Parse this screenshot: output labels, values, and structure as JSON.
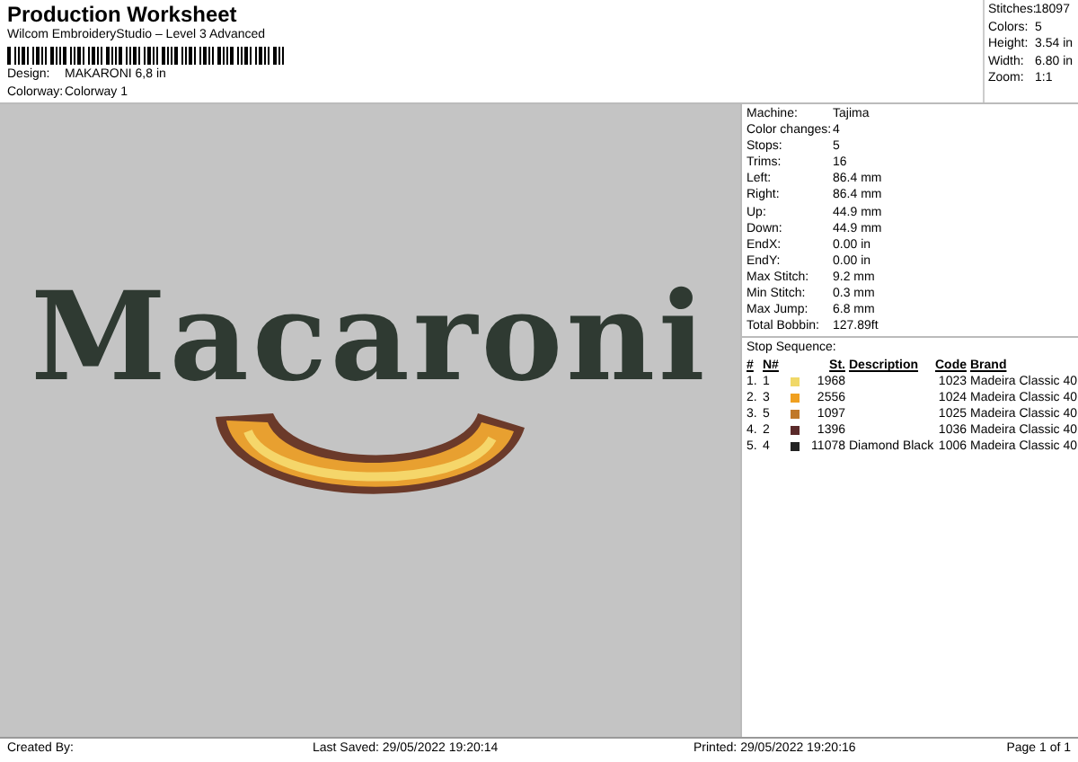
{
  "header": {
    "title": "Production Worksheet",
    "subtitle": "Wilcom EmbroideryStudio – Level 3 Advanced",
    "fields": [
      {
        "label": "Design:",
        "value": "MAKARONI 6,8 in"
      },
      {
        "label": "Colorway:",
        "value": "Colorway 1"
      }
    ]
  },
  "summary": [
    {
      "label": "Stitches:",
      "value": "18097"
    },
    {
      "label": "Colors:",
      "value": "5"
    },
    {
      "label": "Height:",
      "value": "3.54 in"
    },
    {
      "label": "Width:",
      "value": "6.80 in"
    },
    {
      "label": "Zoom:",
      "value": "1:1"
    }
  ],
  "design": {
    "text": "Macaroni"
  },
  "details": [
    {
      "label": "Machine:",
      "value": "Tajima"
    },
    {
      "label": "Color changes:",
      "value": "4"
    },
    {
      "label": "Stops:",
      "value": "5"
    },
    {
      "label": "Trims:",
      "value": "16"
    },
    {
      "label": "Left:",
      "value": "86.4 mm"
    },
    {
      "label": "Right:",
      "value": "86.4 mm"
    },
    {
      "label": "Up:",
      "value": "44.9 mm"
    },
    {
      "label": "Down:",
      "value": "44.9 mm"
    },
    {
      "label": "EndX:",
      "value": "0.00 in"
    },
    {
      "label": "EndY:",
      "value": "0.00 in"
    },
    {
      "label": "Max Stitch:",
      "value": "9.2 mm"
    },
    {
      "label": "Min Stitch:",
      "value": "0.3 mm"
    },
    {
      "label": "Max Jump:",
      "value": "6.8 mm"
    },
    {
      "label": "Total Bobbin:",
      "value": "127.89ft"
    }
  ],
  "stop_sequence": {
    "title": "Stop Sequence:",
    "columns": [
      "#",
      "N#",
      "St.",
      "Description",
      "Code",
      "Brand"
    ],
    "rows": [
      {
        "index": "1.",
        "needle": "1",
        "color": "#f0d868",
        "stitches": "1968",
        "code": "1023",
        "brand": "Madeira Classic 40"
      },
      {
        "index": "2.",
        "needle": "3",
        "color": "#f0a020",
        "stitches": "2556",
        "code": "1024",
        "brand": "Madeira Classic 40"
      },
      {
        "index": "3.",
        "needle": "5",
        "color": "#c07828",
        "stitches": "1097",
        "code": "1025",
        "brand": "Madeira Classic 40"
      },
      {
        "index": "4.",
        "needle": "2",
        "color": "#5a2a2a",
        "stitches": "1396",
        "code": "1036",
        "brand": "Madeira Classic 40"
      },
      {
        "index": "5.",
        "needle": "4",
        "color": "#222222",
        "stitches": "11078",
        "description": "Diamond Black",
        "code": "1006",
        "brand": "Madeira Classic 40"
      }
    ]
  },
  "footer": {
    "created_by": "Created By:",
    "last_saved": "Last Saved: 29/05/2022 19:20:14",
    "printed": "Printed: 29/05/2022 19:20:16",
    "page": "Page 1 of 1"
  }
}
